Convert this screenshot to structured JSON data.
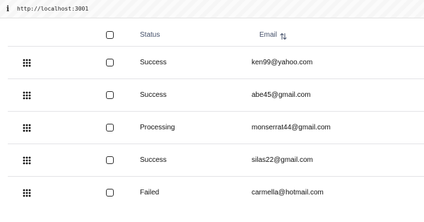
{
  "browser": {
    "url": "http://localhost:3001",
    "info_icon": "info-icon"
  },
  "table": {
    "headers": {
      "status": "Status",
      "email": "Email",
      "sort_icon": "sort-arrows-icon"
    },
    "rows": [
      {
        "status": "Success",
        "email": "ken99@yahoo.com"
      },
      {
        "status": "Success",
        "email": "abe45@gmail.com"
      },
      {
        "status": "Processing",
        "email": "monserrat44@gmail.com"
      },
      {
        "status": "Success",
        "email": "silas22@gmail.com"
      },
      {
        "status": "Failed",
        "email": "carmella@hotmail.com"
      }
    ]
  }
}
